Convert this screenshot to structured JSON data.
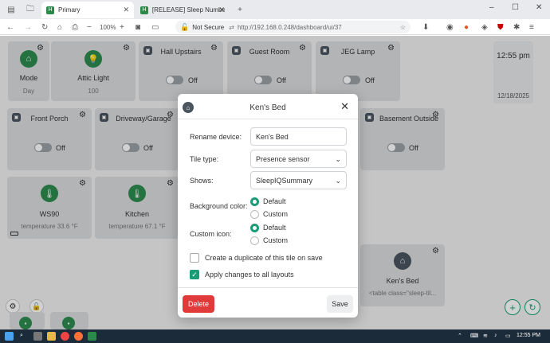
{
  "browser": {
    "tabs": [
      {
        "title": "Primary",
        "active": true
      },
      {
        "title": "[RELEASE] Sleep Number Controlle",
        "active": false
      }
    ],
    "new_tab": "+",
    "zoom": "100%",
    "security": "Not Secure",
    "url": "http://192.168.0.248/dashboard/ui/37",
    "window_controls": {
      "minimize": "–",
      "maximize": "☐",
      "close": "✕"
    }
  },
  "tiles": {
    "mode": {
      "name": "Mode",
      "value": "Day"
    },
    "attic": {
      "name": "Attic Light",
      "value": "100"
    },
    "hall": {
      "name": "Hall Upstairs",
      "state": "Off"
    },
    "guest": {
      "name": "Guest Room",
      "state": "Off"
    },
    "jeg": {
      "name": "JEG Lamp",
      "state": "Off"
    },
    "clock": {
      "time": "12:55 pm",
      "date": "12/18/2025"
    },
    "porch": {
      "name": "Front Porch",
      "state": "Off"
    },
    "driveway": {
      "name": "Driveway/Garage",
      "state": "Off"
    },
    "basement": {
      "name": "Basement Outside",
      "state": "Off"
    },
    "ws90": {
      "name": "WS90",
      "value": "temperature 33.6 °F"
    },
    "kitchen": {
      "name": "Kitchen",
      "value": "temperature 67.1 °F"
    },
    "kensbed": {
      "name": "Ken's Bed",
      "value": "<table class=\"sleep-til..."
    }
  },
  "dialog": {
    "title": "Ken's Bed",
    "rename_label": "Rename device:",
    "rename_value": "Ken's Bed",
    "tile_type_label": "Tile type:",
    "tile_type_value": "Presence sensor",
    "shows_label": "Shows:",
    "shows_value": "SleepIQSummary",
    "bg_label": "Background color:",
    "bg_options": [
      "Default",
      "Custom"
    ],
    "bg_selected": "Default",
    "icon_label": "Custom icon:",
    "icon_options": [
      "Default",
      "Custom"
    ],
    "icon_selected": "Default",
    "duplicate_label": "Create a duplicate of this tile on save",
    "duplicate_checked": false,
    "apply_label": "Apply changes to all layouts",
    "apply_checked": true,
    "delete_label": "Delete",
    "save_label": "Save"
  },
  "taskbar": {
    "time": "12:55 PM"
  },
  "colors": {
    "accent": "#1a9c77",
    "delete": "#e03a3a",
    "tile": "#d9dcdf",
    "icon_green": "#2d8b4f"
  }
}
